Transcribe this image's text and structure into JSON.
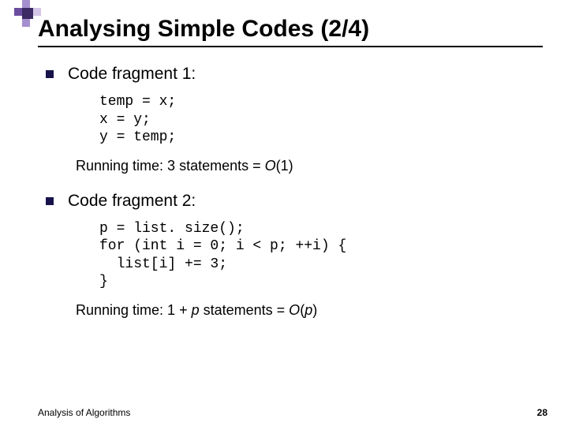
{
  "title": "Analysing Simple Codes (2/4)",
  "bullets": {
    "frag1": "Code fragment 1:",
    "frag2": "Code fragment 2:"
  },
  "code": {
    "block1": "temp = x;\nx = y;\ny = temp;",
    "block2": "p = list. size();\nfor (int i = 0; i < p; ++i) {\n  list[i] += 3;\n}"
  },
  "running": {
    "r1_prefix": "Running time: 3 statements = ",
    "r1_bigO_open": "O",
    "r1_bigO_arg": "(1)",
    "r2_prefix": "Running time: 1 + ",
    "r2_p": "p",
    "r2_mid": " statements = ",
    "r2_bigO_open": "O",
    "r2_bigO_arg_open": "(",
    "r2_bigO_var": "p",
    "r2_bigO_arg_close": ")"
  },
  "footer": {
    "label": "Analysis of Algorithms",
    "page": "28"
  }
}
